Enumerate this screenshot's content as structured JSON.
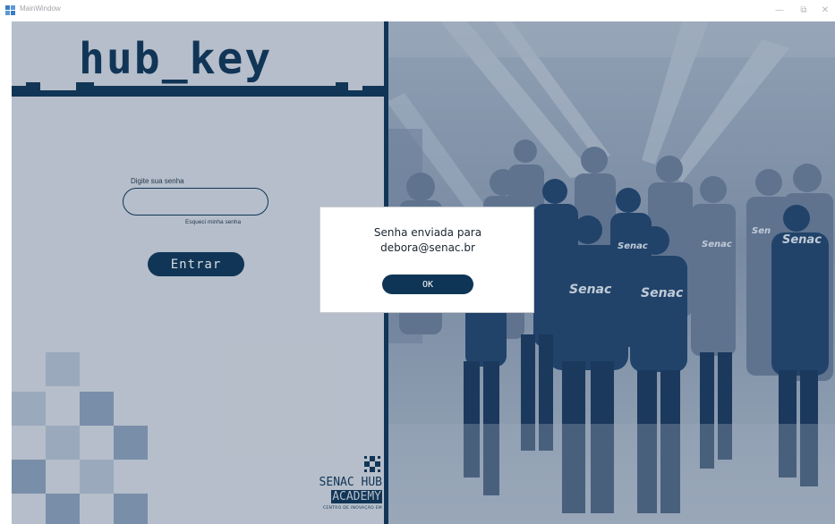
{
  "window": {
    "title": "MainWindow",
    "minimize_glyph": "—",
    "maximize_glyph": "⧉",
    "close_glyph": "✕"
  },
  "login": {
    "logo": "hub_key",
    "password_label": "Digite sua senha",
    "password_value": "",
    "password_placeholder": "",
    "forgot_link": "Esqueci minha senha",
    "submit_label": "Entrar"
  },
  "brand": {
    "line1": "SENAC HUB",
    "line2": "ACADEMY",
    "line3": "CENTRO DE INOVAÇÃO EM"
  },
  "photo": {
    "shirt_texts": [
      "Senac",
      "Senac",
      "Senac",
      "Senac",
      "Senac",
      "Sen"
    ]
  },
  "dialog": {
    "message_line1": "Senha enviada para",
    "message_line2": "debora@senac.br",
    "ok_label": "OK"
  },
  "colors": {
    "primary": "#0f3556",
    "left_background": "#d7dce3",
    "pixel_block": "#8ea2bb"
  }
}
